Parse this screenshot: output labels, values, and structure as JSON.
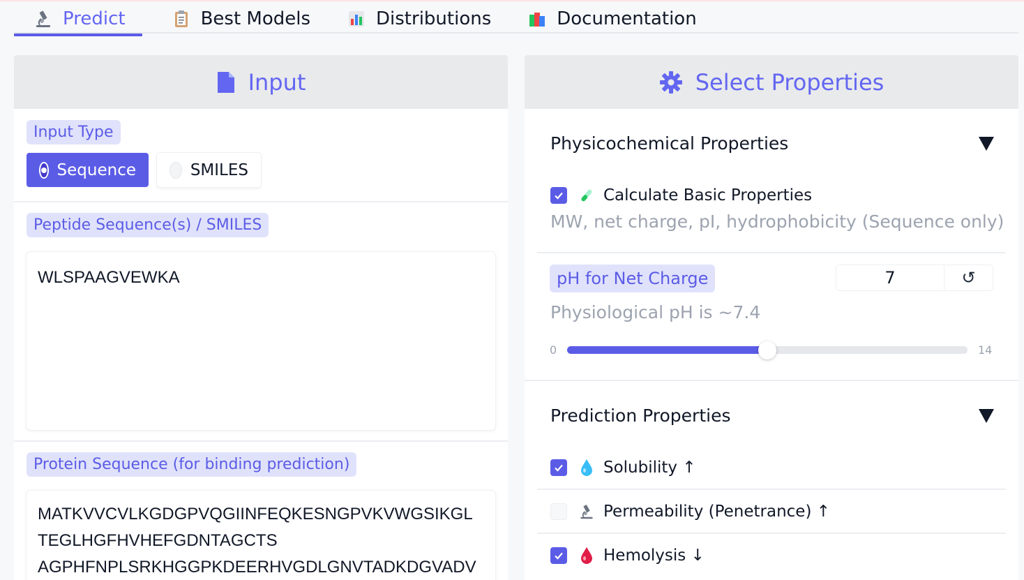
{
  "tabs": [
    {
      "label": "Predict",
      "icon": "microscope-icon"
    },
    {
      "label": "Best Models",
      "icon": "clipboard-icon"
    },
    {
      "label": "Distributions",
      "icon": "bar-chart-icon"
    },
    {
      "label": "Documentation",
      "icon": "books-icon"
    }
  ],
  "input_panel": {
    "title": "Input",
    "input_type_label": "Input Type",
    "input_type_options": [
      "Sequence",
      "SMILES"
    ],
    "input_type_selected": "Sequence",
    "peptide_label": "Peptide Sequence(s) / SMILES",
    "peptide_value": "WLSPAAGVEWKA",
    "protein_label": "Protein Sequence (for binding prediction)",
    "protein_lines": [
      "MATKVVCVLKGDGPVQGIINFEQKESNGPVKVWGSIKGL",
      "TEGLHGFHVHEFGDNTAGCTS",
      "AGPHFNPLSRKHGGPKDEERHVGDLGNVTADKDGVADV"
    ]
  },
  "properties_panel": {
    "title": "Select Properties",
    "physicochemical": {
      "title": "Physicochemical Properties",
      "basic_label": "Calculate Basic Properties",
      "basic_checked": true,
      "basic_desc": "MW, net charge, pI, hydrophobicity (Sequence only)",
      "ph_label": "pH for Net Charge",
      "ph_value": "7",
      "ph_reset_glyph": "↺",
      "ph_hint": "Physiological pH is ~7.4",
      "ph_min": "0",
      "ph_max": "14",
      "ph_fraction": 0.5
    },
    "prediction": {
      "title": "Prediction Properties",
      "items": [
        {
          "label": "Solubility ↑",
          "checked": true,
          "icon": "droplet-icon"
        },
        {
          "label": "Permeability (Penetrance) ↑",
          "checked": false,
          "icon": "microscope-icon"
        },
        {
          "label": "Hemolysis ↓",
          "checked": true,
          "icon": "blood-drop-icon"
        }
      ]
    }
  },
  "colors": {
    "accent": "#5b5ce6",
    "accent_text": "#6366f1",
    "chip_bg": "#e0e2fb",
    "header_bg": "#e9eaec"
  }
}
